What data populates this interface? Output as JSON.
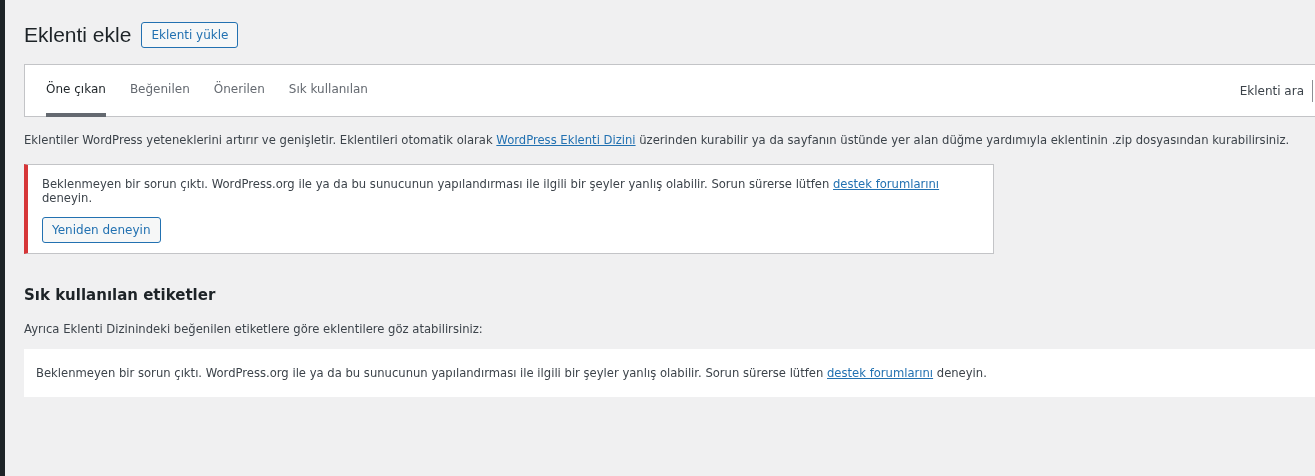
{
  "page_title": "Eklenti ekle",
  "upload_button": "Eklenti yükle",
  "tabs": [
    {
      "label": "Öne çıkan",
      "selected": true
    },
    {
      "label": "Beğenilen",
      "selected": false
    },
    {
      "label": "Önerilen",
      "selected": false
    },
    {
      "label": "Sık kullanılan",
      "selected": false
    }
  ],
  "search": {
    "label": "Eklenti ara"
  },
  "description": {
    "before": "Eklentiler WordPress yeteneklerini artırır ve genişletir. Eklentileri otomatik olarak ",
    "link": "WordPress Eklenti Dizini",
    "after": " üzerinden kurabilir ya da sayfanın üstünde yer alan düğme yardımıyla eklentinin .zip dosyasından kurabilirsiniz."
  },
  "error_notice": {
    "before": "Beklenmeyen bir sorun çıktı. WordPress.org ile ya da bu sunucunun yapılandırması ile ilgili bir şeyler yanlış olabilir. Sorun sürerse lütfen ",
    "link": "destek forumlarını",
    "after": " deneyin.",
    "button": "Yeniden deneyin"
  },
  "tags_section": {
    "heading": "Sık kullanılan etiketler",
    "intro": "Ayrıca Eklenti Dizinindeki beğenilen etiketlere göre eklentilere göz atabilirsiniz:"
  },
  "tags_error": {
    "before": "Beklenmeyen bir sorun çıktı. WordPress.org ile ya da bu sunucunun yapılandırması ile ilgili bir şeyler yanlış olabilir. Sorun sürerse lütfen ",
    "link": "destek forumlarını",
    "after": " deneyin."
  }
}
